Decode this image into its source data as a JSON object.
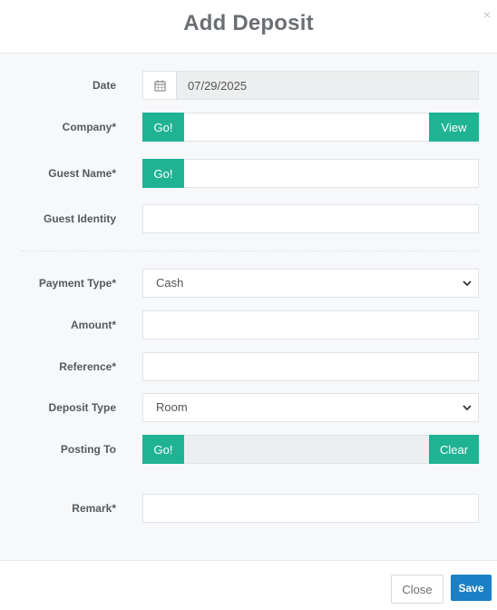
{
  "modal": {
    "title": "Add Deposit",
    "close_symbol": "×"
  },
  "form": {
    "date": {
      "label": "Date",
      "value": "07/29/2025",
      "icon": "calendar-icon"
    },
    "company": {
      "label": "Company*",
      "go_label": "Go!",
      "view_label": "View",
      "value": ""
    },
    "guest_name": {
      "label": "Guest Name*",
      "go_label": "Go!",
      "value": ""
    },
    "guest_identity": {
      "label": "Guest Identity",
      "value": ""
    },
    "payment_type": {
      "label": "Payment Type*",
      "selected": "Cash"
    },
    "amount": {
      "label": "Amount*",
      "value": ""
    },
    "reference": {
      "label": "Reference*",
      "value": ""
    },
    "deposit_type": {
      "label": "Deposit Type",
      "selected": "Room"
    },
    "posting_to": {
      "label": "Posting To",
      "go_label": "Go!",
      "clear_label": "Clear"
    },
    "remark": {
      "label": "Remark*",
      "value": ""
    }
  },
  "footer": {
    "close_label": "Close",
    "save_label": "Save"
  },
  "colors": {
    "teal_button": "#1fb394",
    "save_button": "#1b80c6",
    "title_text": "#6b6f73"
  }
}
